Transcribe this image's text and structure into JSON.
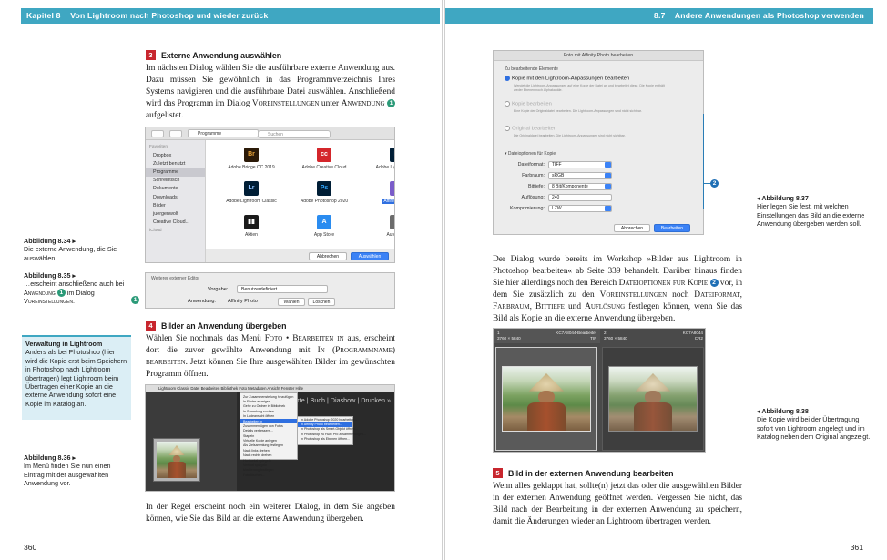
{
  "left": {
    "header": {
      "chapter": "Kapitel 8",
      "title": "Von Lightroom nach Photoshop und wieder zurück"
    },
    "step3": {
      "num": "3",
      "title": "Externe Anwendung auswählen",
      "text_a": "Im nächsten Dialog wählen Sie die ausführbare externe Anwendung aus. Dazu müssen Sie gewöhnlich in das Programmverzeichnis Ihres Systems navigieren und die ausführbare Datei auswählen. Anschließend wird das Programm im Dialog ",
      "sc_1": "Voreinstellungen",
      "text_b": " unter ",
      "sc_2": "Anwendung",
      "bullet": "1",
      "text_c": " aufgelistet."
    },
    "finder": {
      "location": "Programme",
      "search": "Suchen",
      "sidebar_group_fav": "Favoriten",
      "sidebar_items": [
        "Dropbox",
        "Zuletzt benutzt",
        "Programme",
        "Schreibtisch",
        "Dokumente",
        "Downloads",
        "Bilder",
        "juergenwolf",
        "Creative Cloud..."
      ],
      "sidebar_group_icloud": "iCloud",
      "apps": [
        {
          "name": "Adobe Bridge CC 2019",
          "glyph": "Br",
          "color": "#2b1a08",
          "fg": "#e8a338"
        },
        {
          "name": "Adobe Creative Cloud",
          "glyph": "cc",
          "color": "#d4262b",
          "fg": "#ffffff"
        },
        {
          "name": "Adobe Lightroom CC",
          "glyph": "Lr",
          "color": "#001e36",
          "fg": "#8cc0ff"
        },
        {
          "name": "Adobe Lightroom Classic",
          "glyph": "Lr",
          "color": "#001e36",
          "fg": "#8cc0ff"
        },
        {
          "name": "Adobe Photoshop 2020",
          "glyph": "Ps",
          "color": "#001e36",
          "fg": "#31a8ff"
        },
        {
          "name": "Affinity Photo",
          "glyph": "◆",
          "color": "#7a5cc9",
          "fg": "#ffffff"
        },
        {
          "name": "Aktien",
          "glyph": "▮▮",
          "color": "#1b1b1b",
          "fg": "#ffffff"
        },
        {
          "name": "App Store",
          "glyph": "A",
          "color": "#2a8cf0",
          "fg": "#ffffff"
        },
        {
          "name": "Automator",
          "glyph": "⚙",
          "color": "#6b6b6b",
          "fg": "#ffffff"
        }
      ],
      "cancel": "Abbrechen",
      "choose": "Auswählen"
    },
    "cap_834": {
      "label": "Abbildung 8.34 ▸",
      "text": "Die externe Anwendung, die Sie auswählen …"
    },
    "cap_835": {
      "label": "Abbildung 8.35 ▸",
      "text_a": "…erscheint anschließend auch bei ",
      "sc": "Anwendung",
      "bullet": "1",
      "text_b": " im Dialog ",
      "sc2": "Voreinstellungen",
      "text_c": "."
    },
    "editor": {
      "title": "Weiterer externer Editor",
      "preset_label": "Vorgabe:",
      "preset_value": "Benutzerdefiniert",
      "app_label": "Anwendung:",
      "app_value": "Affinity Photo",
      "choose": "Wählen",
      "delete": "Löschen",
      "bullet": "1"
    },
    "box": {
      "title": "Verwaltung in Lightroom",
      "text": "Anders als bei Photoshop (hier wird die Kopie erst beim Speichern in Photoshop nach Lightroom übertragen) legt Lightroom beim Übertragen einer Kopie an die externe Anwendung sofort eine Kopie im Katalog an."
    },
    "step4": {
      "num": "4",
      "title": "Bilder an Anwendung übergeben",
      "text_a": "Wählen Sie nochmals das Menü ",
      "sc_1": "Foto",
      "text_b": " • ",
      "sc_2": "Bearbeiten in",
      "text_c": " aus, erscheint dort die zuvor gewählte Anwendung mit ",
      "sc_3": "In (Programmname) bearbeiten",
      "text_d": ". Jetzt können Sie Ihre ausgewählten Bilder im gewünschten Programm öffnen."
    },
    "cap_836": {
      "label": "Abbildung 8.36 ▸",
      "text": "Im Menü finden Sie nun einen Eintrag mit der ausgewählten Anwendung vor."
    },
    "lr": {
      "menubar": "Lightroom Classic   Datei   Bearbeiten   Bibliothek   Foto   Metadaten   Ansicht   Fenster   Hilfe",
      "nav": "| Karte | Buch | Diashow | Drucken »",
      "menu_items": [
        "Zur Zusammenstellung hinzufügen",
        "In Finder anzeigen",
        "Gehe zu Ordner in Bibliothek",
        "In Sammlung suchen",
        "In Ladeansicht öffnen",
        "Bearbeiten in",
        "Zusammenfügen von Fotos",
        "Details verbessern...",
        "Stapeln",
        "Virtuelle Kopie anlegen",
        "Als Zielsammlung festlegen",
        "Nach links drehen",
        "Nach rechts drehen",
        "Horizontal spiegeln",
        "Vertikal spiegeln",
        "Markierung festlegen",
        "Foto löschen..."
      ],
      "menu_highlight": 5,
      "sub_items": [
        "In Adobe Photoshop 2020 bearbeiten...",
        "In Affinity Photo bearbeiten...",
        "In Photoshop als Smart-Objekt öffnen...",
        "In Photoshop zu HDR Pro zusammenfügen...",
        "In Photoshop als Ebenen öffnen..."
      ],
      "sub_highlight": 1
    },
    "closing": "In der Regel erscheint noch ein weiterer Dialog, in dem Sie angeben können, wie Sie das Bild an die externe Anwendung übergeben.",
    "folio": "360"
  },
  "right": {
    "header": {
      "section": "8.7",
      "title": "Andere Anwendungen als Photoshop verwenden"
    },
    "aff": {
      "title": "Foto mit Affinity Photo bearbeiten",
      "section": "Zu bearbeitende Elemente",
      "opt1": "Kopie mit den Lightroom-Anpassungen bearbeiten",
      "opt1_note": "Wendet die Lightroom-Anpassungen auf eine Kopie der Datei an und bearbeitet diese. Die Kopie enthält weder Ebenen noch Alphakanäle.",
      "opt2": "Kopie bearbeiten",
      "opt2_note": "Eine Kopie der Originaldatei bearbeiten. Die Lightroom-Anpassungen sind nicht sichtbar.",
      "opt3": "Original bearbeiten",
      "opt3_note": "Die Originaldatei bearbeiten. Die Lightroom-Anpassungen sind nicht sichtbar.",
      "file_options": "Dateioptionen für Kopie",
      "fields": [
        {
          "label": "Dateiformat:",
          "value": "TIFF"
        },
        {
          "label": "Farbraum:",
          "value": "sRGB"
        },
        {
          "label": "Bittiefe:",
          "value": "8 Bit/Komponente"
        },
        {
          "label": "Auflösung:",
          "value": "240"
        },
        {
          "label": "Komprimierung:",
          "value": "LZW"
        }
      ],
      "cancel": "Abbrechen",
      "edit": "Bearbeiten",
      "bullet": "2"
    },
    "cap_837": {
      "label": "◂ Abbildung 8.37",
      "text": "Hier legen Sie fest, mit welchen Einstellungen das Bild an die externe Anwendung übergeben werden soll."
    },
    "para": {
      "text_a": "Der Dialog wurde bereits im Workshop »Bilder aus Lightroom in Photoshop bearbeiten« ab Seite 339 behandelt. Darüber hinaus finden Sie hier allerdings noch den Bereich ",
      "sc_1": "Dateioptionen für Kopie",
      "bullet": "2",
      "text_b": " vor, in dem Sie zusätzlich zu den ",
      "sc_2": "Voreinstellungen",
      "text_c": " noch ",
      "sc_3": "Dateiformat, Farbraum, Bittiefe",
      "text_d": " und ",
      "sc_4": "Auflösung",
      "text_e": " festlegen können, wenn Sie das Bild als Kopie an die externe Anwendung übergeben."
    },
    "cmp": {
      "left_num": "1",
      "left_file": "KC7A8044-Bearbeitet",
      "left_dims": "3760 × 5840",
      "left_ext": "TIF",
      "right_num": "2",
      "right_file": "KC7A8044",
      "right_dims": "3760 × 5840",
      "right_ext": "CR2"
    },
    "cap_838": {
      "label": "◂ Abbildung 8.38",
      "text": "Die Kopie wird bei der Übertragung sofort von Lightroom angelegt und im Katalog neben dem Original angezeigt."
    },
    "step5": {
      "num": "5",
      "title": "Bild in der externen Anwendung bearbeiten",
      "text": "Wenn alles geklappt hat, sollte(n) jetzt das oder die ausgewählten Bilder in der externen Anwendung geöffnet werden. Vergessen Sie nicht, das Bild nach der Bearbeitung in der externen Anwendung zu speichern, damit die Änderungen wieder an Lightroom übertragen werden."
    },
    "folio": "361"
  },
  "colors": {
    "header": "#3fa7c2",
    "step": "#c8262e",
    "bullet_teal": "#2b9a78",
    "bullet_blue": "#1f6fb5",
    "box": "#dbeef5"
  }
}
